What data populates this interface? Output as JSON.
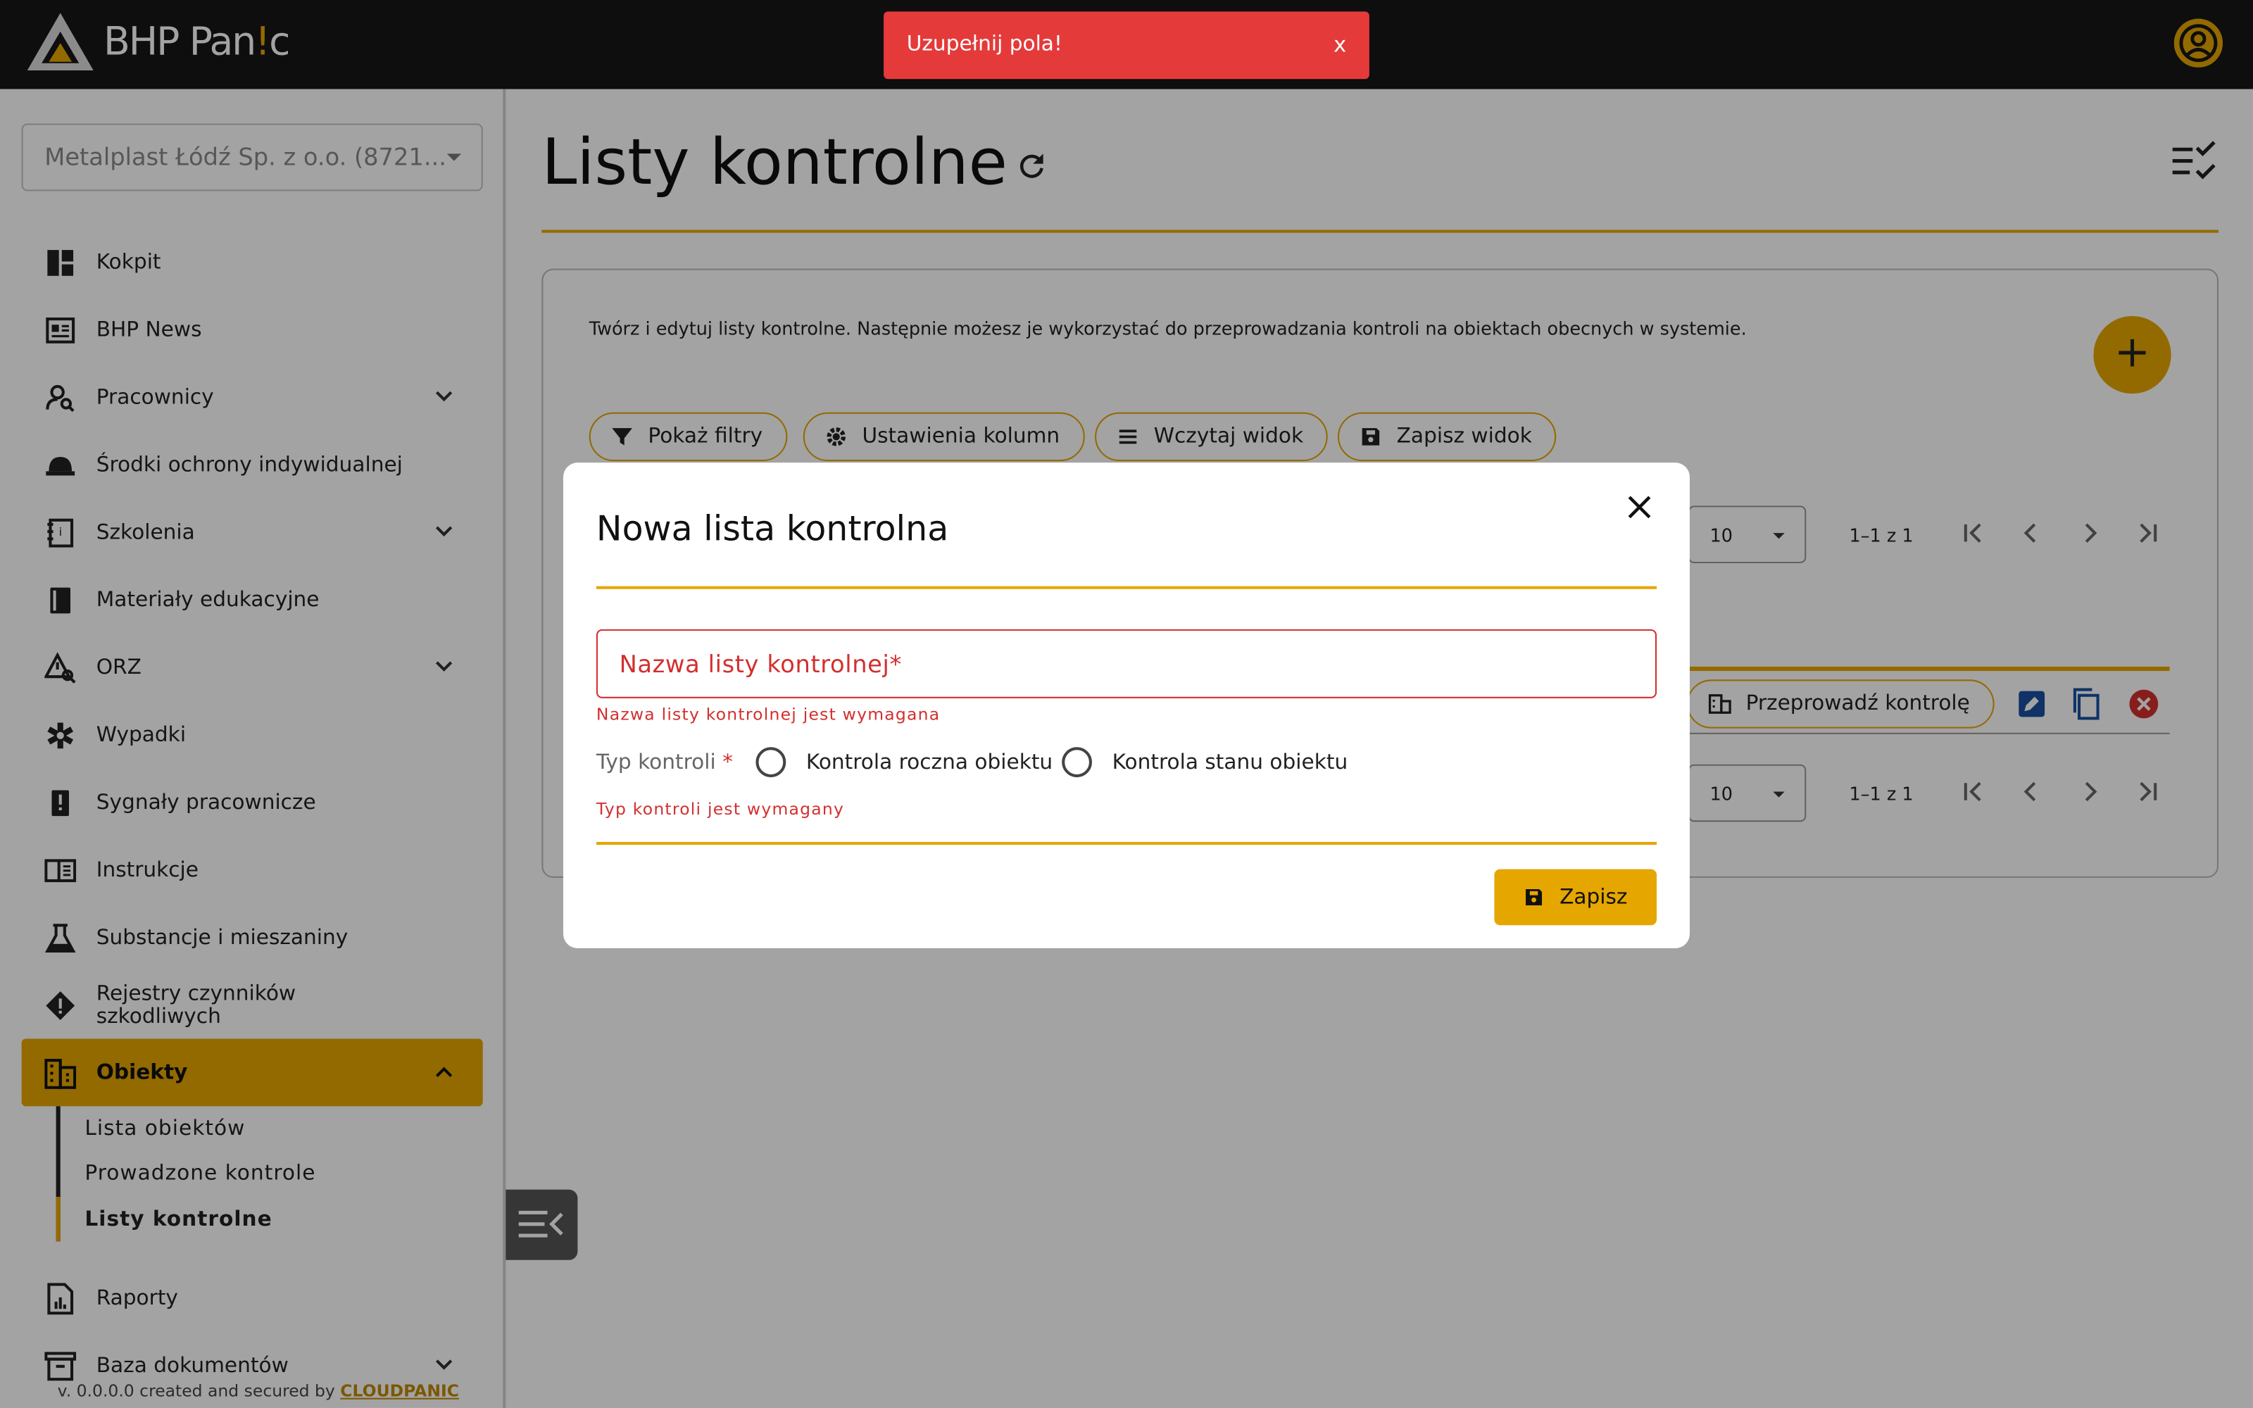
{
  "app": {
    "brand_prefix": "BHP Pan",
    "brand_mid": "!",
    "brand_suffix": "c"
  },
  "toast": {
    "message": "Uzupełnij pola!",
    "close_label": "x"
  },
  "sidebar": {
    "company_select": "Metalplast Łódź Sp. z o.o. (8721...",
    "items": [
      {
        "label": "Kokpit",
        "icon": "dashboard-icon"
      },
      {
        "label": "BHP News",
        "icon": "news-icon"
      },
      {
        "label": "Pracownicy",
        "icon": "person-search-icon",
        "expandable": true
      },
      {
        "label": "Środki ochrony indywidualnej",
        "icon": "helmet-icon"
      },
      {
        "label": "Szkolenia",
        "icon": "training-book-icon",
        "expandable": true
      },
      {
        "label": "Materiały edukacyjne",
        "icon": "book-icon"
      },
      {
        "label": "ORZ",
        "icon": "risk-assessment-icon",
        "expandable": true
      },
      {
        "label": "Wypadki",
        "icon": "medical-star-icon"
      },
      {
        "label": "Sygnały pracownicze",
        "icon": "alert-report-icon"
      },
      {
        "label": "Instrukcje",
        "icon": "instructions-icon"
      },
      {
        "label": "Substancje i mieszaniny",
        "icon": "flask-icon"
      },
      {
        "label": "Rejestry czynników szkodliwych",
        "icon": "warning-diamond-icon"
      },
      {
        "label": "Obiekty",
        "icon": "building-icon",
        "expandable": true,
        "active": true
      },
      {
        "label": "Raporty",
        "icon": "report-icon"
      },
      {
        "label": "Baza dokumentów",
        "icon": "archive-icon",
        "expandable": true
      }
    ],
    "sub_items": [
      {
        "label": "Lista obiektów"
      },
      {
        "label": "Prowadzone kontrole"
      },
      {
        "label": "Listy kontrolne",
        "current": true
      }
    ],
    "footer_prefix": "v. 0.0.0.0 created and secured by ",
    "footer_link": "CLOUDPANIC"
  },
  "main": {
    "title": "Listy kontrolne",
    "description": "Twórz i edytuj listy kontrolne. Następnie możesz je wykorzystać do przeprowadzania kontroli na obiektach obecnych w systemie.",
    "fab_label": "+",
    "toolbar": {
      "show_filters": "Pokaż filtry",
      "column_settings": "Ustawienia kolumn",
      "load_view": "Wczytaj widok",
      "save_view": "Zapisz widok"
    },
    "pager": {
      "rows_per_page": "10",
      "range": "1–1 z 1"
    },
    "row_action": "Przeprowadź kontrolę"
  },
  "modal": {
    "title": "Nowa lista kontrolna",
    "name_placeholder": "Nazwa listy kontrolnej*",
    "name_error": "Nazwa listy kontrolnej jest wymagana",
    "type_label": "Typ kontroli",
    "type_required": "*",
    "options": [
      "Kontrola roczna obiektu",
      "Kontrola stanu obiektu"
    ],
    "type_error": "Typ kontroli jest wymagany",
    "save_label": "Zapisz"
  },
  "colors": {
    "accent": "#e6a600",
    "error": "#d32f2f",
    "toast": "#e53a3a",
    "topbar": "#161616"
  }
}
